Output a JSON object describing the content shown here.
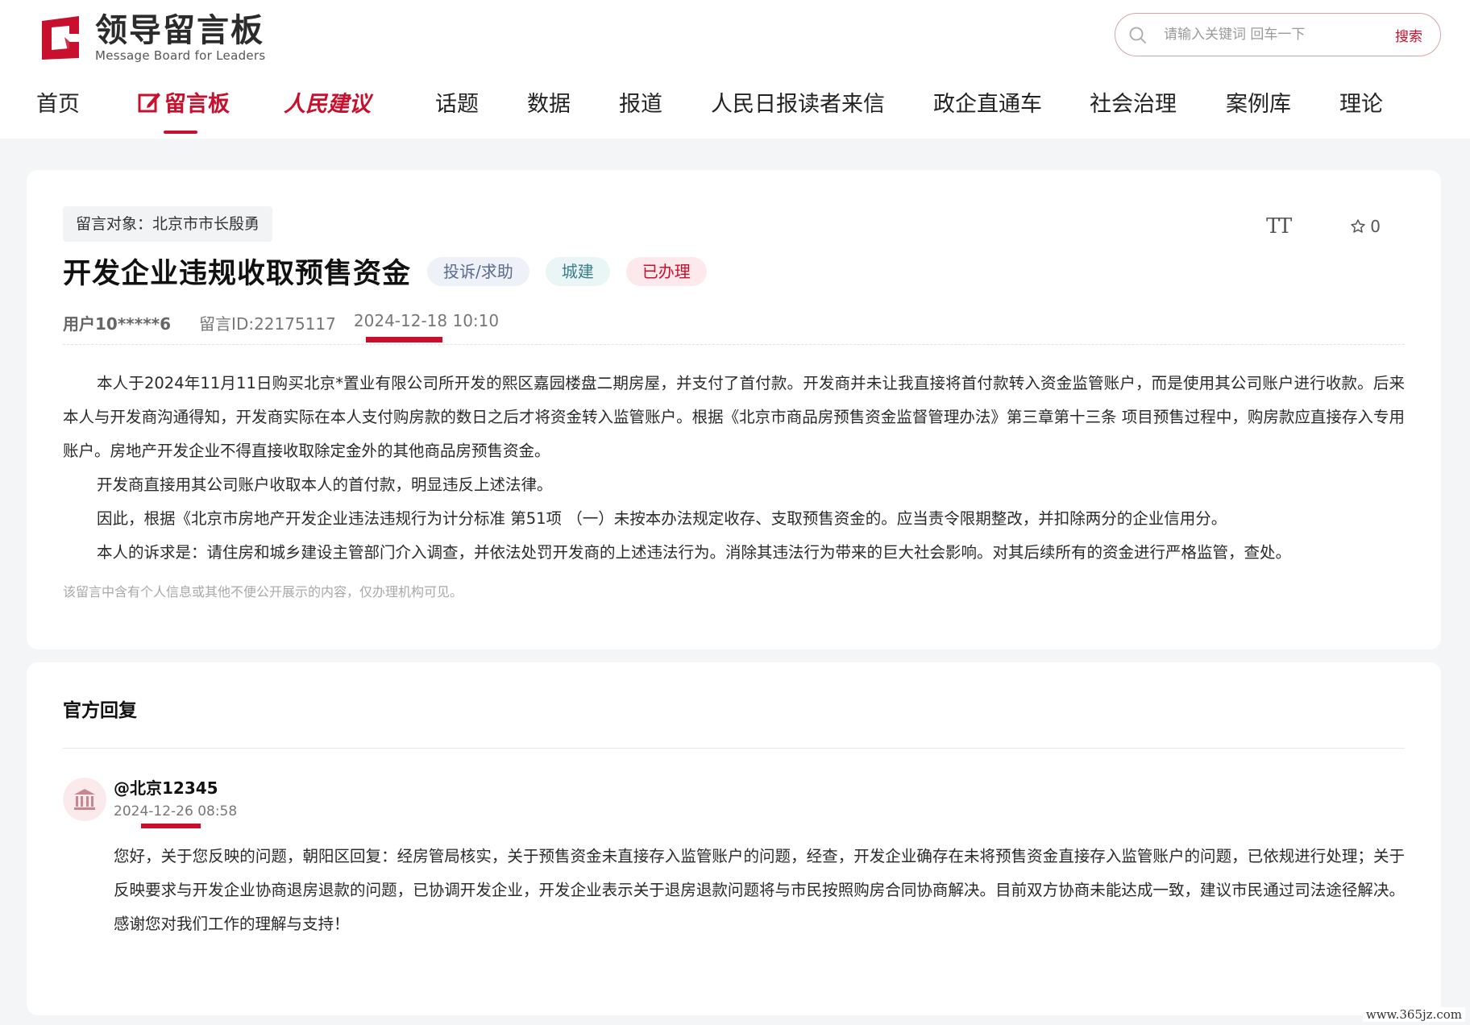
{
  "header": {
    "logo_title": "领导留言板",
    "logo_subtitle": "Message Board for Leaders",
    "search_placeholder": "请输入关键词 回车一下",
    "search_button": "搜索"
  },
  "nav": {
    "items": [
      {
        "label": "首页"
      },
      {
        "label": "留言板",
        "active": true
      },
      {
        "label": "人民建议"
      },
      {
        "label": "话题"
      },
      {
        "label": "数据"
      },
      {
        "label": "报道"
      },
      {
        "label": "人民日报读者来信"
      },
      {
        "label": "政企直通车"
      },
      {
        "label": "社会治理"
      },
      {
        "label": "案例库"
      },
      {
        "label": "理论"
      }
    ]
  },
  "message": {
    "target": "留言对象：北京市市长殷勇",
    "title": "开发企业违规收取预售资金",
    "tags": [
      "投诉/求助",
      "城建",
      "已办理"
    ],
    "font_tool": "TT",
    "favorite_count": "0",
    "user": "用户10*****6",
    "message_id": "留言ID:22175117",
    "datetime": "2024-12-18 10:10",
    "paragraphs": [
      "本人于2024年11月11日购买北京*置业有限公司所开发的熙区嘉园楼盘二期房屋，并支付了首付款。开发商并未让我直接将首付款转入资金监管账户，而是使用其公司账户进行收款。后来本人与开发商沟通得知，开发商实际在本人支付购房款的数日之后才将资金转入监管账户。根据《北京市商品房预售资金监督管理办法》第三章第十三条  项目预售过程中，购房款应直接存入专用账户。房地产开发企业不得直接收取除定金外的其他商品房预售资金。",
      "开发商直接用其公司账户收取本人的首付款，明显违反上述法律。",
      "因此，根据《北京市房地产开发企业违法违规行为计分标准  第51项  （一）未按本办法规定收存、支取预售资金的。应当责令限期整改，并扣除两分的企业信用分。",
      "本人的诉求是：请住房和城乡建设主管部门介入调查，并依法处罚开发商的上述违法行为。消除其违法行为带来的巨大社会影响。对其后续所有的资金进行严格监管，查处。"
    ],
    "privacy_notice": "该留言中含有个人信息或其他不便公开展示的内容，仅办理机构可见。"
  },
  "reply": {
    "heading": "官方回复",
    "name": "@北京12345",
    "datetime": "2024-12-26 08:58",
    "body": "您好，关于您反映的问题，朝阳区回复：经房管局核实，关于预售资金未直接存入监管账户的问题，经查，开发企业确存在未将预售资金直接存入监管账户的问题，已依规进行处理；关于反映要求与开发企业协商退房退款的问题，已协调开发企业，开发企业表示关于退房退款问题将与市民按照购房合同协商解决。目前双方协商未能达成一致，建议市民通过司法途径解决。感谢您对我们工作的理解与支持！"
  },
  "watermark": "www.365jz.com",
  "colors": {
    "accent": "#c8102e",
    "page_bg": "#f4f5f7"
  }
}
